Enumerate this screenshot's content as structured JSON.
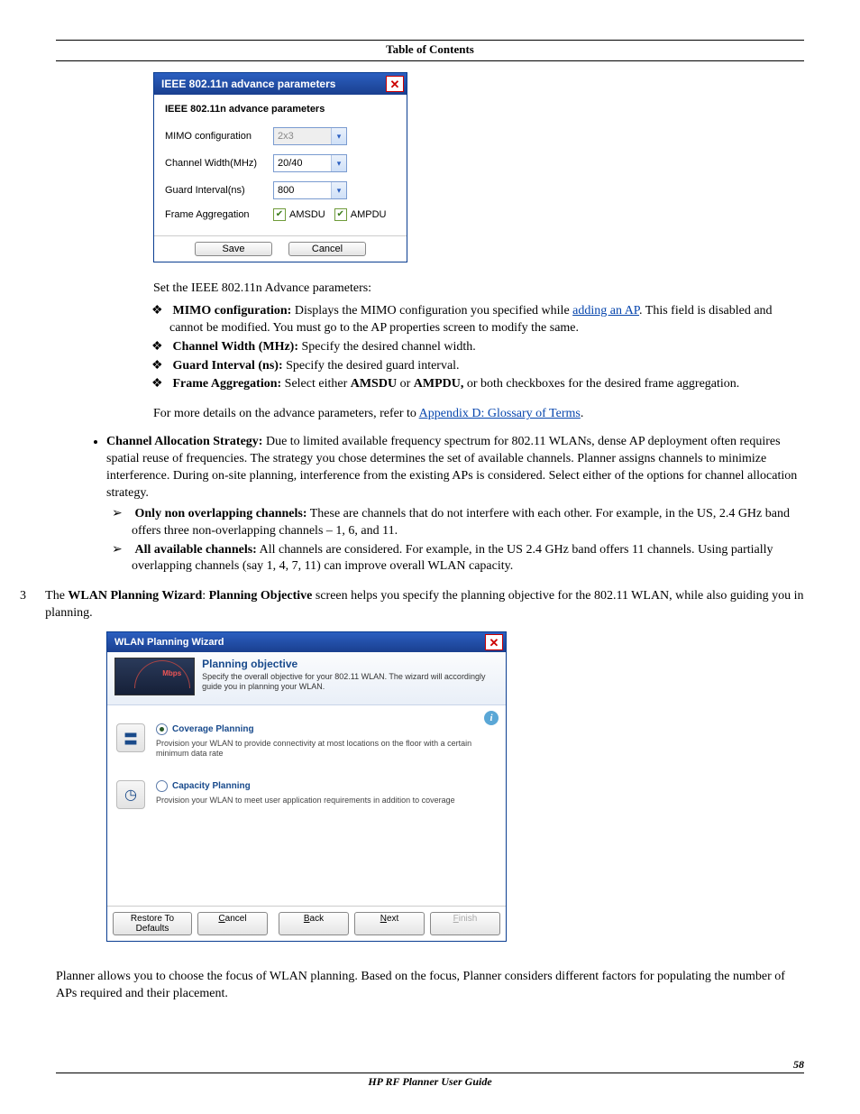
{
  "header": {
    "toc": "Table of Contents"
  },
  "dialog1": {
    "title": "IEEE 802.11n advance parameters",
    "subtitle": "IEEE 802.11n advance parameters",
    "rows": {
      "mimo": {
        "label": "MIMO configuration",
        "value": "2x3"
      },
      "width": {
        "label": "Channel Width(MHz)",
        "value": "20/40"
      },
      "guard": {
        "label": "Guard Interval(ns)",
        "value": "800"
      },
      "frame": {
        "label": "Frame Aggregation",
        "opt1": "AMSDU",
        "opt2": "AMPDU"
      }
    },
    "buttons": {
      "save": "Save",
      "cancel": "Cancel"
    }
  },
  "text": {
    "intro": "Set the IEEE 802.11n Advance parameters:",
    "b1_label": "MIMO configuration:",
    "b1_text1": " Displays the MIMO configuration you specified while ",
    "b1_link": "adding an AP",
    "b1_text2": ". This field is disabled and cannot be modified. You must go to the AP properties screen to modify the same.",
    "b2_label": "Channel Width (MHz):",
    "b2_text": " Specify the desired channel width.",
    "b3_label": "Guard Interval (ns):",
    "b3_text": " Specify the desired guard interval.",
    "b4_label": "Frame Aggregation:",
    "b4_text1": " Select either ",
    "b4_bold1": "AMSDU",
    "b4_mid": " or ",
    "b4_bold2": "AMPDU,",
    "b4_text2": " or both checkboxes for the desired frame aggregation.",
    "more1": "For more details on the advance parameters, refer to ",
    "more_link": "Appendix D: Glossary of Terms",
    "more2": ".",
    "cas_label": "Channel Allocation Strategy:",
    "cas_text": " Due to limited available frequency spectrum for 802.11 WLANs, dense AP deployment often requires spatial reuse of frequencies. The strategy you chose determines the set of available channels. Planner assigns channels to minimize interference. During on-site planning, interference from the existing APs is considered. Select either of the options for channel allocation strategy.",
    "a1_label": "Only non overlapping channels:",
    "a1_text": " These are channels that do not interfere with each other. For example, in the US, 2.4 GHz band offers three non-overlapping channels – 1, 6, and 11.",
    "a2_label": "All available channels:",
    "a2_text": " All channels are considered. For example, in the US 2.4 GHz band offers 11 channels. Using partially overlapping channels (say 1, 4, 7, 11) can improve overall WLAN capacity.",
    "step3_num": "3",
    "step3_a": "The ",
    "step3_b1": "WLAN Planning Wizard",
    "step3_b": ": ",
    "step3_b2": "Planning Objective",
    "step3_c": " screen helps you specify the planning objective for the 802.11 WLAN, while also guiding you in planning.",
    "tail": "Planner allows you to choose the focus of WLAN planning. Based on the focus, Planner considers different factors for populating the number of APs required and their placement."
  },
  "dialog2": {
    "title": "WLAN Planning Wizard",
    "head_title": "Planning objective",
    "head_desc": "Specify the overall objective for your 802.11 WLAN. The wizard will accordingly guide you in planning your WLAN.",
    "gauge_label": "Mbps",
    "opt1": {
      "label": "Coverage Planning",
      "desc": "Provision your WLAN to provide connectivity at most locations on the floor with a certain minimum data rate"
    },
    "opt2": {
      "label": "Capacity Planning",
      "desc": "Provision your WLAN to meet user application requirements in addition to coverage"
    },
    "buttons": {
      "restore": "Restore To Defaults",
      "cancel_u": "C",
      "cancel_r": "ancel",
      "back_u": "B",
      "back_r": "ack",
      "next_u": "N",
      "next_r": "ext",
      "finish_u": "F",
      "finish_r": "inish"
    }
  },
  "footer": {
    "title": "HP RF Planner User Guide",
    "page": "58"
  }
}
